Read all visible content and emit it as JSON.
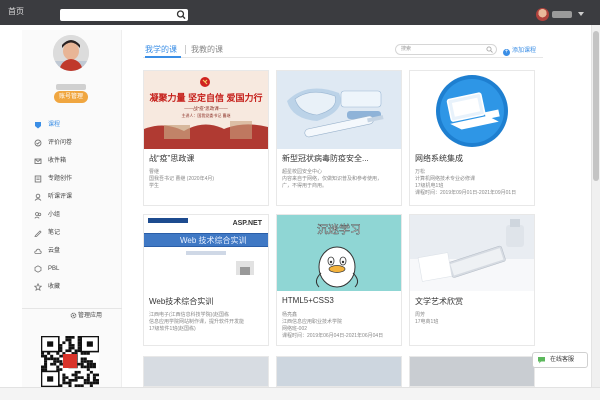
{
  "topbar": {
    "home_label": "首页",
    "search_value": ""
  },
  "sidebar": {
    "edit_profile_label": "账号管理",
    "nav_items": [
      {
        "label": "课程",
        "icon": "course-icon",
        "active": true
      },
      {
        "label": "评价问卷",
        "icon": "survey-icon",
        "active": false
      },
      {
        "label": "收件箱",
        "icon": "inbox-icon",
        "active": false
      },
      {
        "label": "专题创作",
        "icon": "topic-icon",
        "active": false
      },
      {
        "label": "听课评课",
        "icon": "lesson-review-icon",
        "active": false
      },
      {
        "label": "小组",
        "icon": "group-icon",
        "active": false
      },
      {
        "label": "笔记",
        "icon": "notes-icon",
        "active": false
      },
      {
        "label": "云盘",
        "icon": "cloud-drive-icon",
        "active": false
      },
      {
        "label": "PBL",
        "icon": "pbl-icon",
        "active": false
      },
      {
        "label": "收藏",
        "icon": "favorites-icon",
        "active": false
      }
    ],
    "manage_apps_label": "管理应用"
  },
  "main": {
    "tabs": [
      {
        "label": "我学的课",
        "active": true
      },
      {
        "label": "我教的课",
        "active": false
      }
    ],
    "search_placeholder": "搜索",
    "add_course_label": "添加课程",
    "courses": [
      {
        "title": "战“疫”思政课",
        "lines": [
          "曹继",
          "国我吾书记 曹继 (2020年4月)",
          "学生"
        ],
        "cover": {
          "type": "flag-poster",
          "headline": "凝聚力量 坚定自信 爱国力行",
          "sub": "——战“疫”思政课——",
          "note": "主讲人：国我党委书记 曹继"
        }
      },
      {
        "title": "新型冠状病毒防疫安全...",
        "lines": [
          "超星校园安全中心",
          "内容来自于网络，仅做知识普及和参考使用，",
          "广，不得用于商用。"
        ],
        "cover": {
          "type": "masks"
        }
      },
      {
        "title": "网络系统集成",
        "lines": [
          "万松",
          "计算机网络技术专业必修课",
          "17级机电1班",
          "课程时间：2019年09月01日-2021年09月01日"
        ],
        "cover": {
          "type": "computer-icon"
        }
      },
      {
        "title": "Web技术综合实训",
        "lines": [
          "江西电子(江西信息科技学院)(赵国栋",
          "信息应用学院网站制作课，提升软件开发能",
          "17级软件1班(赵国栋)"
        ],
        "cover": {
          "type": "web-slide",
          "slide_title": "Web 技术综合实训",
          "brand": "ASP.NET"
        }
      },
      {
        "title": "HTML5+CSS3",
        "lines": [
          "杨亮鑫",
          "江西信息应用职业技术学院",
          "网络班-002",
          "课程时间：2019年06月04日-2021年06月04日"
        ],
        "cover": {
          "type": "duck-cartoon",
          "caption": "沉迷学习"
        }
      },
      {
        "title": "文学艺术欣赏",
        "lines": [
          "周芳",
          "17电商1班"
        ],
        "cover": {
          "type": "desk-photo"
        }
      }
    ]
  },
  "float_button_label": "在线客服",
  "colors": {
    "accent": "#3a8ee6",
    "topbar": "#3b3c40",
    "edit_button": "#f0a640"
  }
}
